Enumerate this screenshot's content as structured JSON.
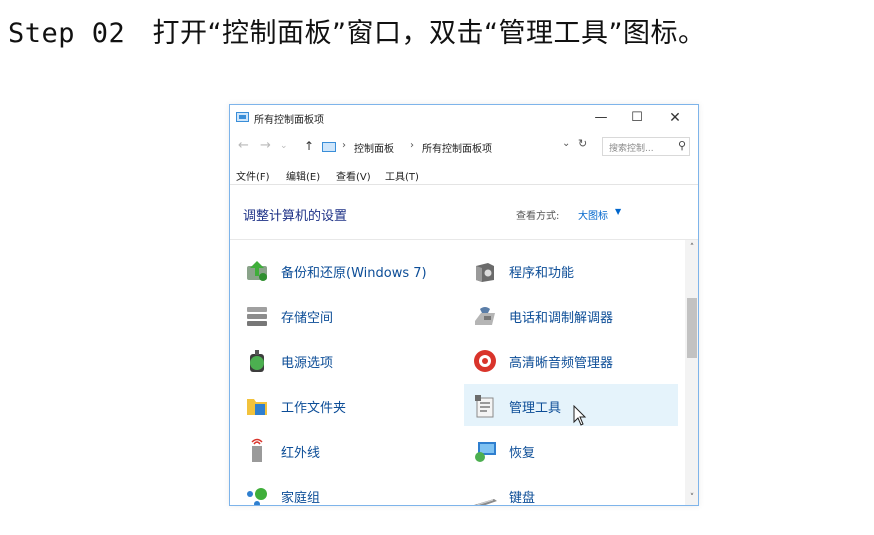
{
  "caption": {
    "step": "Step 02",
    "text": "打开“控制面板”窗口，双击“管理工具”图标。"
  },
  "window": {
    "title": "所有控制面板项",
    "controls": {
      "minimize": "—",
      "maximize": "☐",
      "close": "✕"
    },
    "address": {
      "back": "←",
      "forward": "→",
      "recent": "⌄",
      "up": "↑",
      "breadcrumb": [
        "控制面板",
        "所有控制面板项"
      ],
      "separator": "›",
      "dropdown": "⌄",
      "refresh": "↻",
      "search_placeholder": "搜索控制...",
      "search_glyph": "⚲"
    },
    "menu": [
      "文件(F)",
      "编辑(E)",
      "查看(V)",
      "工具(T)"
    ],
    "header": {
      "title": "调整计算机的设置",
      "view_label": "查看方式:",
      "view_value": "大图标",
      "view_caret": "▼"
    },
    "items": [
      {
        "label": "备份和还原(Windows 7)",
        "icon": "backup-restore-icon"
      },
      {
        "label": "程序和功能",
        "icon": "programs-features-icon"
      },
      {
        "label": "存储空间",
        "icon": "storage-spaces-icon"
      },
      {
        "label": "电话和调制解调器",
        "icon": "phone-modem-icon"
      },
      {
        "label": "电源选项",
        "icon": "power-options-icon"
      },
      {
        "label": "高清晰音频管理器",
        "icon": "hd-audio-icon"
      },
      {
        "label": "工作文件夹",
        "icon": "work-folders-icon"
      },
      {
        "label": "管理工具",
        "icon": "administrative-tools-icon"
      },
      {
        "label": "红外线",
        "icon": "infrared-icon"
      },
      {
        "label": "恢复",
        "icon": "recovery-icon"
      },
      {
        "label": "家庭组",
        "icon": "homegroup-icon"
      },
      {
        "label": "键盘",
        "icon": "keyboard-icon"
      }
    ],
    "scroll": {
      "up": "˄",
      "down": "˅"
    }
  },
  "colors": {
    "window_border": "#7eb4ea",
    "link": "#0c4d97",
    "header_title": "#1e3287",
    "hover": "#e5f3fb"
  }
}
